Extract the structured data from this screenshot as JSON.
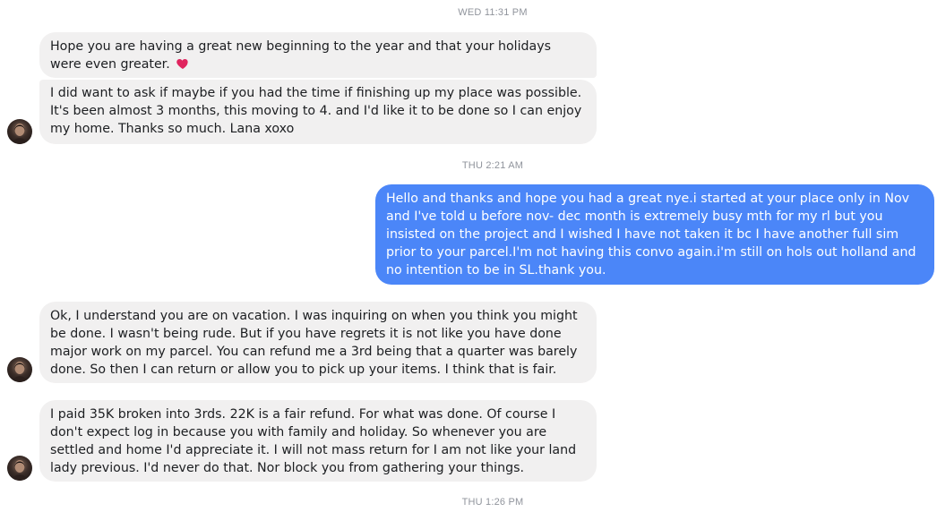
{
  "timestamps": {
    "t1": "WED 11:31 PM",
    "t2": "THU 2:21 AM",
    "t3": "THU 1:26 PM"
  },
  "messages": {
    "m1": "Hope you are having a great new beginning to the year and that your holidays were even greater.",
    "m2": "I did want to ask if maybe if you had the time if finishing up my place was possible. It's been almost 3 months, this moving to 4. and I'd like it to be done so I can enjoy my home. Thanks so much. Lana xoxo",
    "m3": "Hello and thanks and hope you had a  great nye.i started at your place only in Nov and I've told u before nov- dec month is extremely busy mth for my rl but you insisted on the project and I wished I have not taken it bc I have another full sim prior to your parcel.I'm not having this convo again.i'm still on hols out holland and no intention to be in SL.thank you.",
    "m4": "Ok, I understand you are on vacation. I was inquiring on when you think you might be done. I wasn't being rude. But if you have regrets it is not like you have done major work on my parcel. You can refund me a 3rd being that a quarter was barely done. So then I can return or allow you to pick up your items. I think that is fair.",
    "m5": "I paid 35K broken into 3rds. 22K is a fair refund. For what was done. Of course I don't expect log in because you with family and holiday. So whenever you are settled and home I'd appreciate it. I will not mass return for I am not like your land lady previous. I'd never do that. Nor block you from gathering your things."
  },
  "icons": {
    "emoji": "heart-emoji",
    "avatar": "contact-avatar"
  },
  "colors": {
    "incoming_bubble": "#f1f0f0",
    "outgoing_bubble": "#4b86f8",
    "timestamp": "#90949c",
    "heart": "#e0245e"
  }
}
